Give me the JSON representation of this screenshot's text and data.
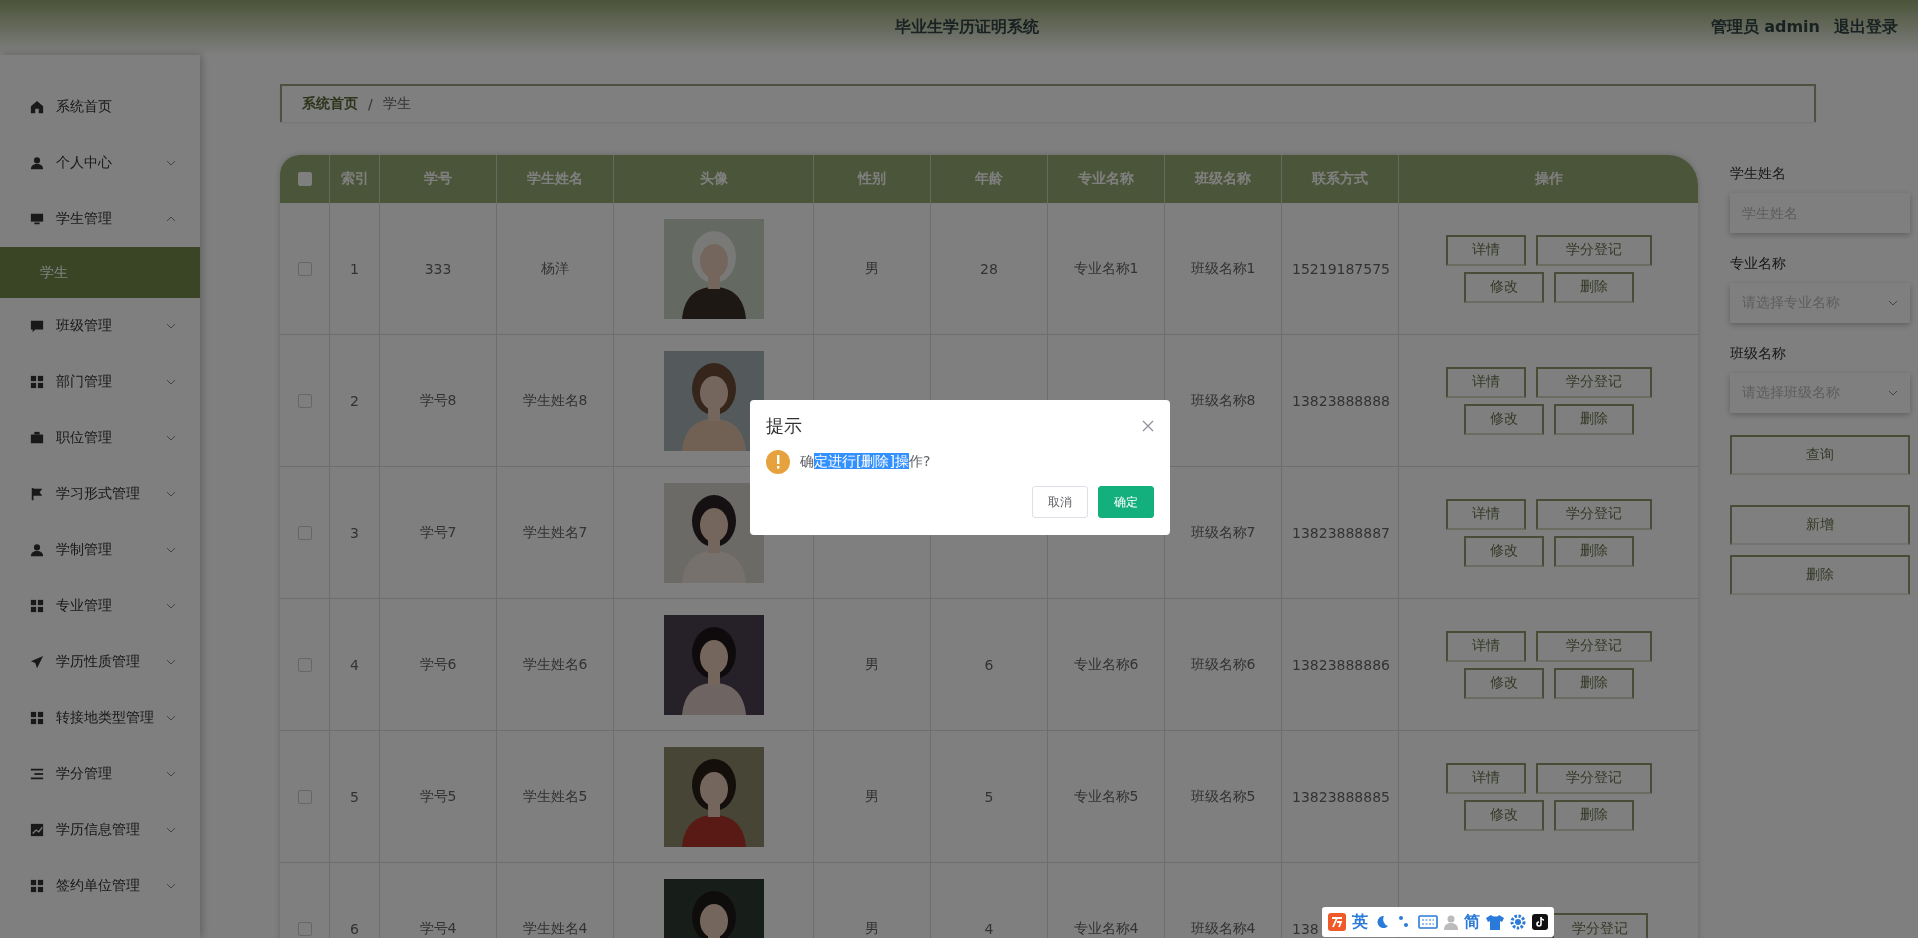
{
  "header": {
    "title": "毕业生学历证明系统",
    "user": "管理员 admin",
    "logout": "退出登录"
  },
  "sidebar": {
    "items": [
      {
        "label": "系统首页"
      },
      {
        "label": "个人中心",
        "expanded": false
      },
      {
        "label": "学生管理",
        "expanded": true,
        "children": [
          {
            "label": "学生",
            "selected": true
          }
        ]
      },
      {
        "label": "班级管理",
        "expanded": false
      },
      {
        "label": "部门管理",
        "expanded": false
      },
      {
        "label": "职位管理",
        "expanded": false
      },
      {
        "label": "学习形式管理",
        "expanded": false
      },
      {
        "label": "学制管理",
        "expanded": false
      },
      {
        "label": "专业管理",
        "expanded": false
      },
      {
        "label": "学历性质管理",
        "expanded": false
      },
      {
        "label": "转接地类型管理",
        "expanded": false
      },
      {
        "label": "学分管理",
        "expanded": false
      },
      {
        "label": "学历信息管理",
        "expanded": false
      },
      {
        "label": "签约单位管理",
        "expanded": false
      }
    ]
  },
  "breadcrumb": [
    "系统首页",
    "/",
    "学生"
  ],
  "table": {
    "select_all": {
      "checked": false
    },
    "columns": [
      "索引",
      "学号",
      "学生姓名",
      "头像",
      "性别",
      "年龄",
      "专业名称",
      "班级名称",
      "联系方式",
      "操作"
    ],
    "rows": [
      {
        "checked": false,
        "index": "1",
        "number": "333",
        "name": "杨洋",
        "avatar": {
          "kind": "picture"
        },
        "gender": "男",
        "age": "28",
        "major": "专业名称1",
        "class": "班级名称1",
        "phone": "15219187575",
        "actions": [
          "详情",
          "学分登记",
          "修改",
          "删除"
        ]
      },
      {
        "checked": false,
        "index": "2",
        "number": "学号8",
        "name": "学生姓名8",
        "avatar": {
          "kind": "picture"
        },
        "class": "班级名称8",
        "phone": "13823888888",
        "actions": [
          "详情",
          "学分登记",
          "修改",
          "删除"
        ]
      },
      {
        "checked": false,
        "index": "3",
        "number": "学号7",
        "name": "学生姓名7",
        "avatar": {
          "kind": "picture"
        },
        "class": "班级名称7",
        "phone": "13823888887",
        "actions": [
          "详情",
          "学分登记",
          "修改",
          "删除"
        ]
      },
      {
        "checked": false,
        "index": "4",
        "number": "学号6",
        "name": "学生姓名6",
        "avatar": {
          "kind": "picture"
        },
        "gender": "男",
        "age": "6",
        "major": "专业名称6",
        "class": "班级名称6",
        "phone": "13823888886",
        "actions": [
          "详情",
          "学分登记",
          "修改",
          "删除"
        ]
      },
      {
        "checked": false,
        "index": "5",
        "number": "学号5",
        "name": "学生姓名5",
        "avatar": {
          "kind": "picture"
        },
        "gender": "男",
        "age": "5",
        "major": "专业名称5",
        "class": "班级名称5",
        "phone": "13823888885",
        "actions": [
          "详情",
          "学分登记",
          "修改",
          "删除"
        ]
      },
      {
        "checked": false,
        "index": "6",
        "number": "学号4",
        "name": "学生姓名4",
        "avatar": {
          "kind": "picture"
        },
        "gender": "男",
        "age": "4",
        "major": "专业名称4",
        "class": "班级名称4",
        "phone": "138",
        "actions": [
          "学分登记"
        ]
      }
    ]
  },
  "search": {
    "fields": [
      {
        "label": "学生姓名",
        "kind": "input",
        "placeholder": "学生姓名"
      },
      {
        "label": "专业名称",
        "kind": "select",
        "placeholder": "请选择专业名称"
      },
      {
        "label": "班级名称",
        "kind": "select",
        "placeholder": "请选择班级名称"
      }
    ],
    "buttons": [
      "查询",
      "新增",
      "删除"
    ]
  },
  "dialog": {
    "title": "提示",
    "message": [
      {
        "text": "确",
        "selected": false
      },
      {
        "text": "定进行[删除]操",
        "selected": true
      },
      {
        "text": "作?",
        "selected": false
      }
    ],
    "buttons": [
      {
        "label": "取消",
        "kind": "default"
      },
      {
        "label": "确定",
        "kind": "primary"
      }
    ]
  },
  "ime_toolbar": {
    "labels": [
      "英",
      "简"
    ]
  }
}
